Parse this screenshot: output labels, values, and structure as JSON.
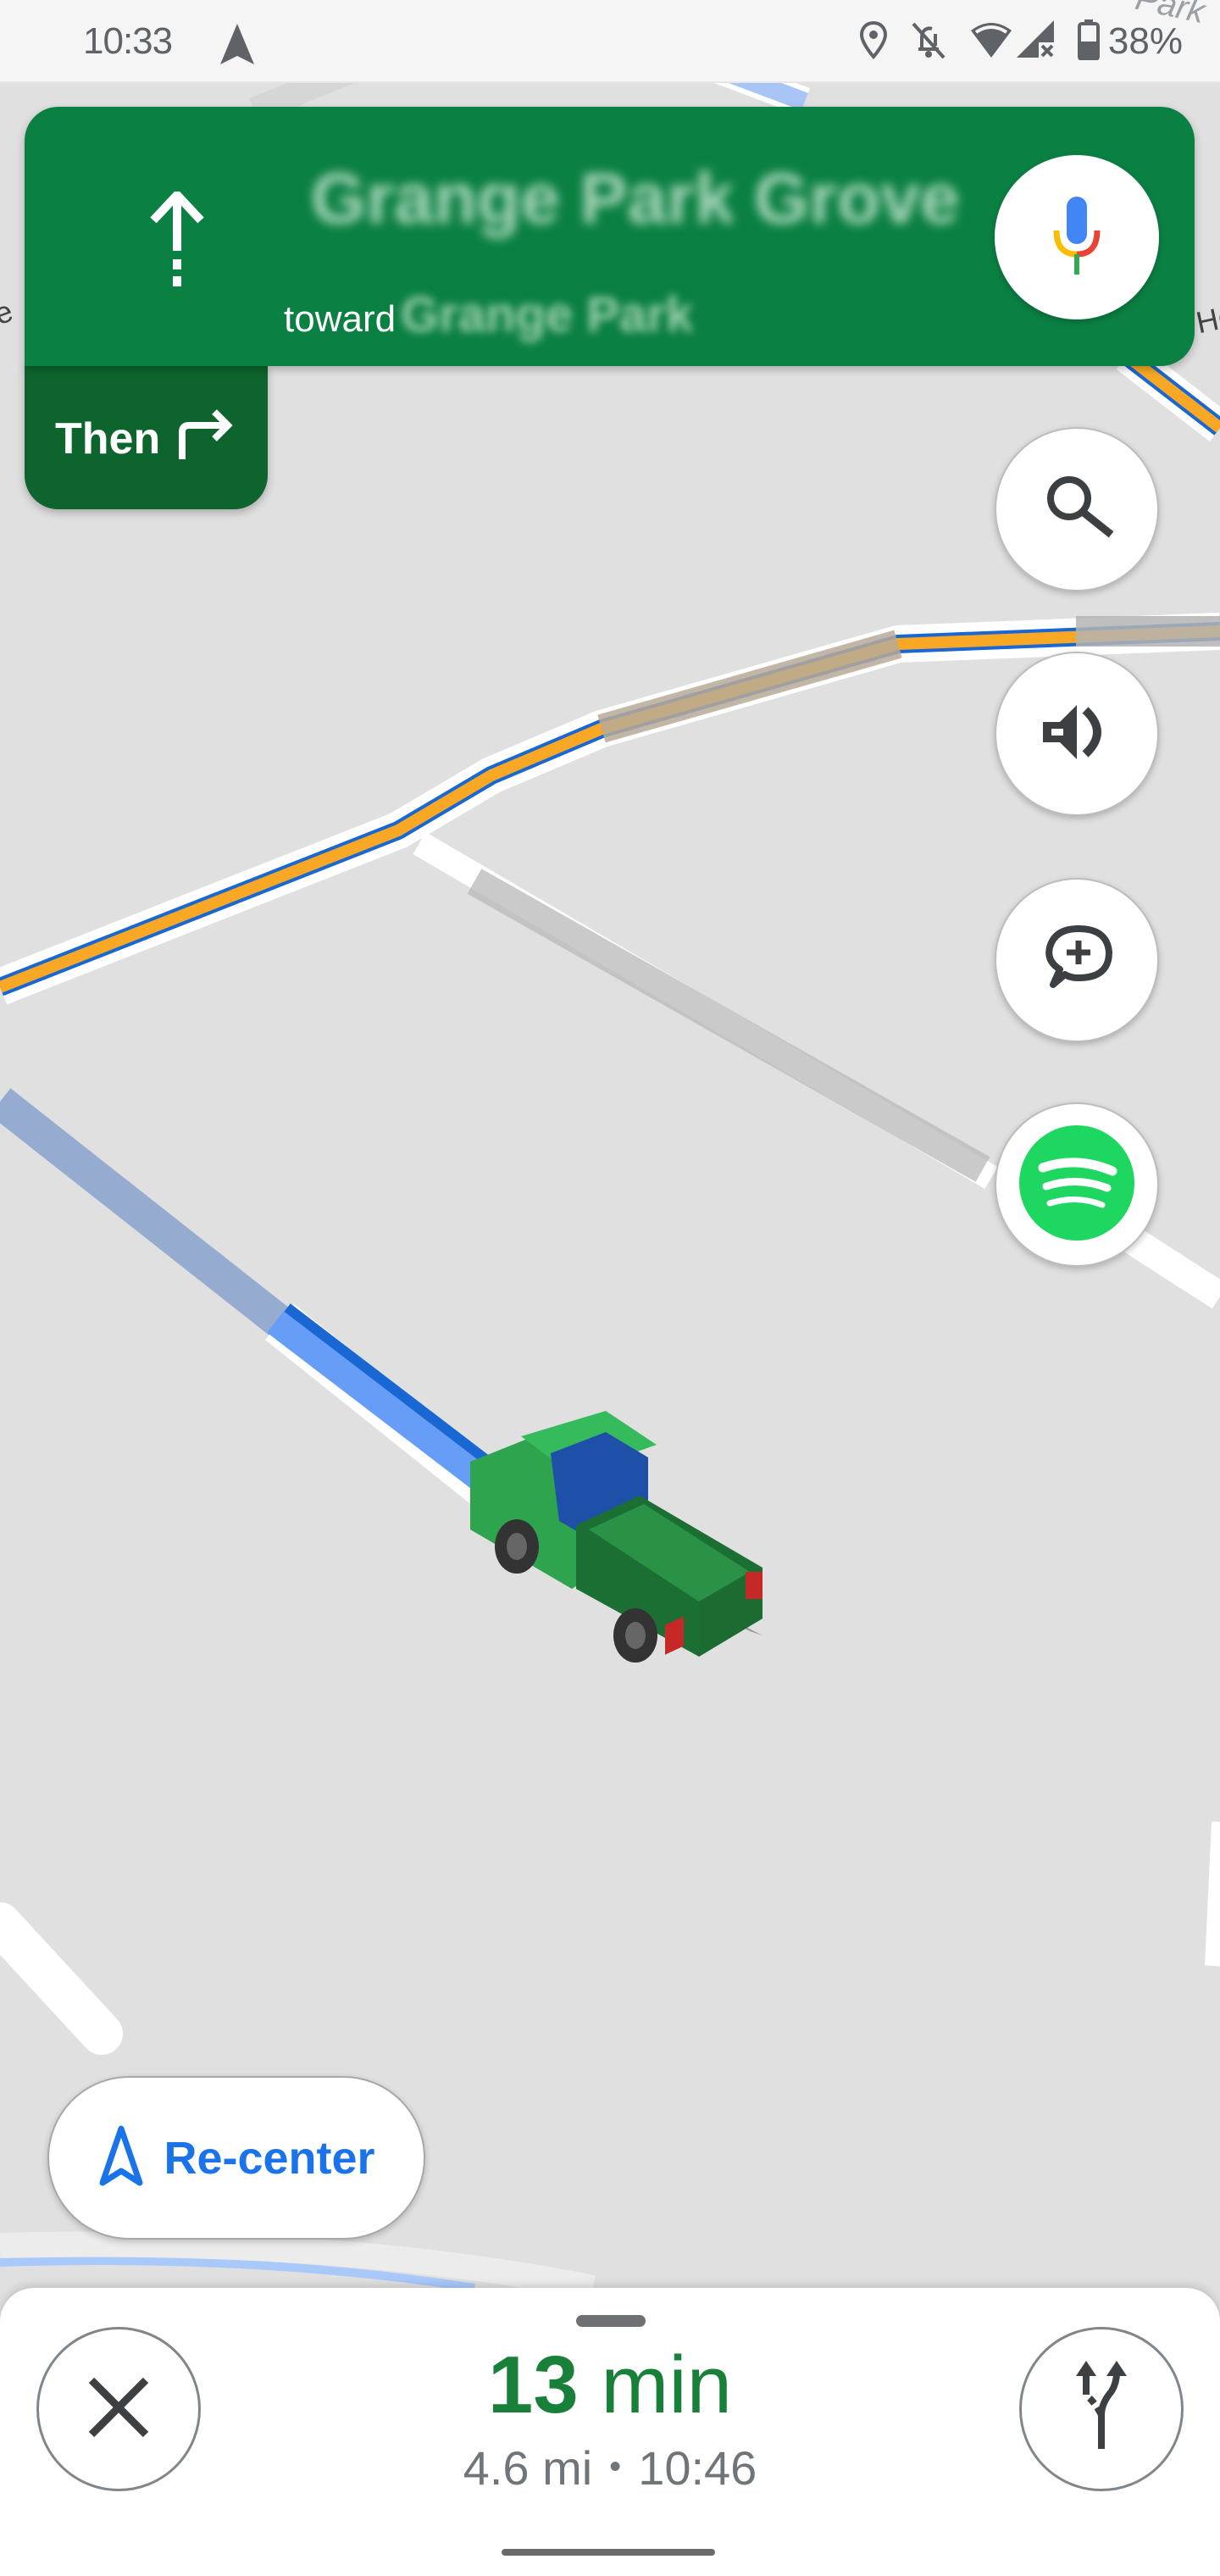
{
  "status_bar": {
    "time": "10:33",
    "battery_percent": "38%",
    "icons": [
      "navigation-arrow-icon",
      "location-icon",
      "alarm-off-icon",
      "wifi-icon",
      "cellular-no-signal-icon",
      "battery-icon"
    ]
  },
  "map": {
    "labels": [
      "Park",
      "e",
      "Ho"
    ],
    "colors": {
      "background": "#e0e0e0",
      "route": "#669df6",
      "route_edge": "#1967d2",
      "highway": "#f9a825",
      "road": "#ffffff"
    }
  },
  "navigation": {
    "maneuver_icon": "straight-arrow-icon",
    "street_name": "Grange Park Grove",
    "toward_label": "toward",
    "toward_destination": "Grange Park",
    "then_label": "Then",
    "then_icon": "turn-right-icon",
    "voice_search_icon": "mic-icon",
    "colors": {
      "primary": "#0b8043",
      "secondary": "#0d652d"
    }
  },
  "side_buttons": [
    {
      "name": "search",
      "icon": "search-icon"
    },
    {
      "name": "sound",
      "icon": "volume-icon"
    },
    {
      "name": "report",
      "icon": "add-report-icon"
    },
    {
      "name": "spotify",
      "icon": "spotify-icon",
      "color": "#1ed760"
    }
  ],
  "recenter": {
    "label": "Re-center",
    "icon": "navigation-arrow-icon",
    "color": "#1a73e8"
  },
  "vehicle": {
    "icon": "pickup-truck-icon"
  },
  "bottom_sheet": {
    "eta_value": "13",
    "eta_unit": "min",
    "distance": "4.6 mi",
    "separator": "•",
    "arrival_time": "10:46",
    "close_icon": "close-icon",
    "alternates_icon": "alternate-routes-icon",
    "eta_color": "#188038"
  }
}
